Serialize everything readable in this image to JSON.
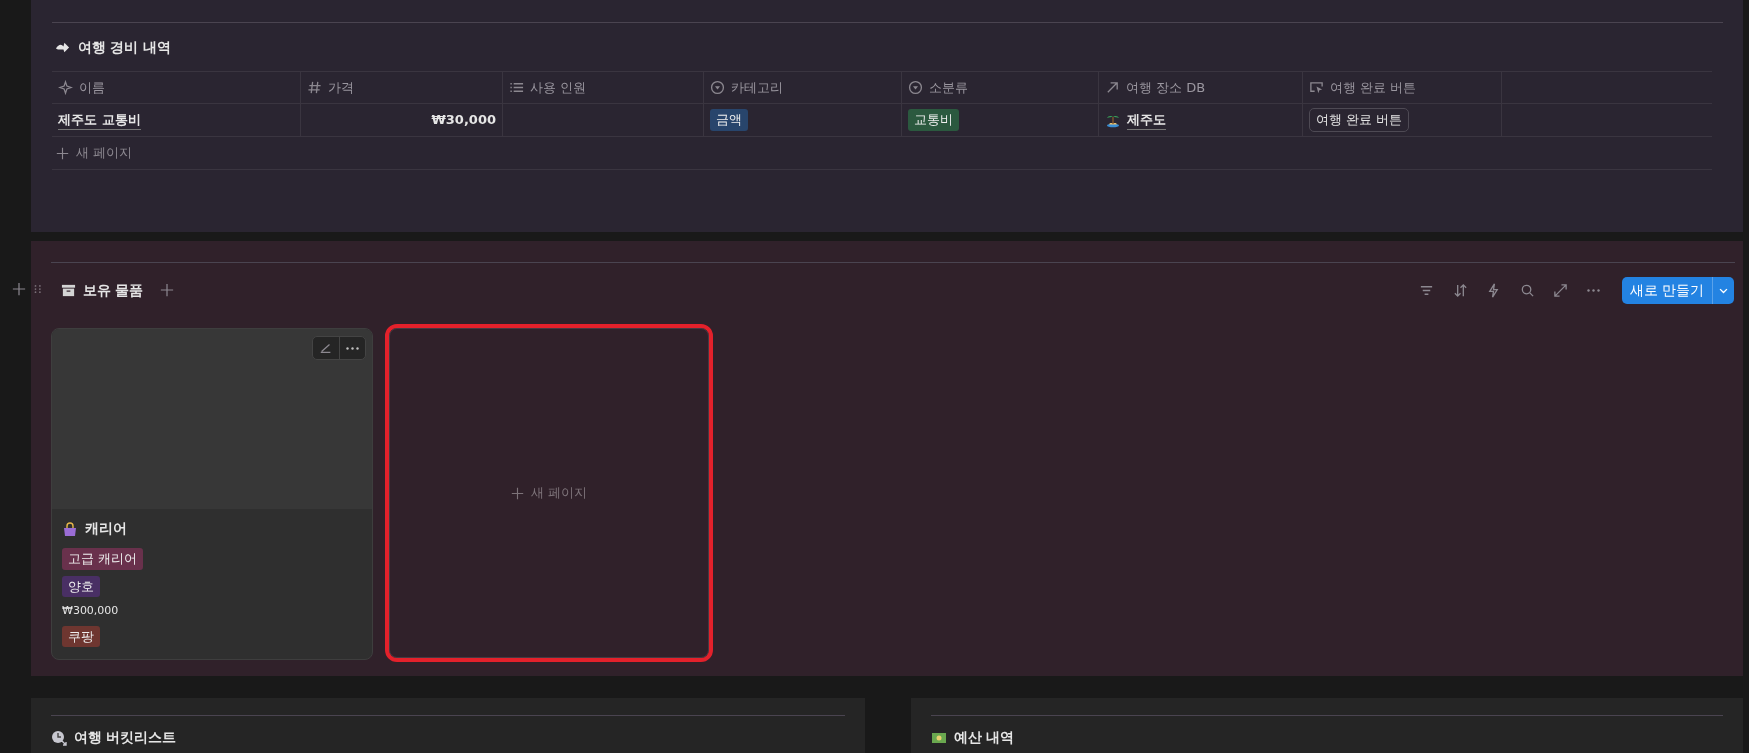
{
  "expense_table": {
    "title": "여행 경비 내역",
    "columns": [
      {
        "label": "이름",
        "kind": "title"
      },
      {
        "label": "가격",
        "kind": "number"
      },
      {
        "label": "사용 인원",
        "kind": "list"
      },
      {
        "label": "카테고리",
        "kind": "select"
      },
      {
        "label": "소분류",
        "kind": "select"
      },
      {
        "label": "여행 장소 DB",
        "kind": "relation"
      },
      {
        "label": "여행 완료 버튼",
        "kind": "button"
      }
    ],
    "rows": [
      {
        "name": "제주도 교통비",
        "price": "₩30,000",
        "category": {
          "label": "금액",
          "color": "#28456c"
        },
        "subcategory": {
          "label": "교통비",
          "color": "#2b593f"
        },
        "place": "제주도",
        "button": "여행 완료 버튼"
      }
    ],
    "new_row": "새 페이지"
  },
  "inventory": {
    "title": "보유 물품",
    "new_button": "새로 만들기",
    "cards": [
      {
        "title": "캐리어",
        "tags": [
          {
            "label": "고급 캐리어",
            "color": "#69314c"
          },
          {
            "label": "양호",
            "color": "#492f64"
          }
        ],
        "price": "₩300,000",
        "store": {
          "label": "쿠팡",
          "color": "#6e3630"
        }
      }
    ],
    "new_card": "새 페이지",
    "new_card_highlighted": true
  },
  "bottom_panels": [
    {
      "title": "여행 버킷리스트"
    },
    {
      "title": "예산 내역"
    }
  ]
}
